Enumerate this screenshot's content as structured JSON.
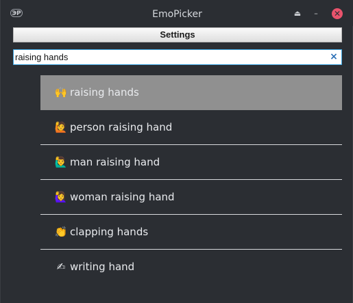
{
  "window": {
    "title": "EmoPicker",
    "app_icon_text": "ЭP"
  },
  "titlebar": {
    "keep_above_glyph": "⏏",
    "minimize_glyph": "–",
    "close_glyph": "✕"
  },
  "settings": {
    "label": "Settings"
  },
  "search": {
    "value": "raising hands",
    "clear_glyph": "×"
  },
  "results": [
    {
      "emoji": "🙌",
      "label": "raising hands",
      "selected": true
    },
    {
      "emoji": "🙋",
      "label": "person raising hand",
      "selected": false
    },
    {
      "emoji": "🙋‍♂️",
      "label": "man raising hand",
      "selected": false
    },
    {
      "emoji": "🙋‍♀️",
      "label": "woman raising hand",
      "selected": false
    },
    {
      "emoji": "👏",
      "label": "clapping hands",
      "selected": false
    },
    {
      "emoji": "✍",
      "label": "writing hand",
      "selected": false
    }
  ],
  "colors": {
    "accent": "#3aa4e0",
    "selected_row": "#909090",
    "close_button": "#e9536c"
  }
}
